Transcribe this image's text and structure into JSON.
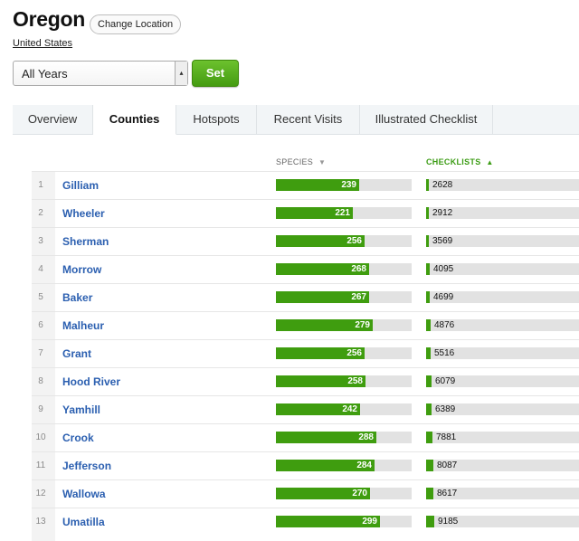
{
  "header": {
    "title": "Oregon",
    "change_location": "Change Location",
    "subtitle": "United States"
  },
  "controls": {
    "year_select": "All Years",
    "set_label": "Set"
  },
  "tabs": [
    {
      "label": "Overview",
      "active": false
    },
    {
      "label": "Counties",
      "active": true
    },
    {
      "label": "Hotspots",
      "active": false
    },
    {
      "label": "Recent Visits",
      "active": false
    },
    {
      "label": "Illustrated Checklist",
      "active": false
    }
  ],
  "columns": {
    "species": "SPECIES",
    "species_sort_icon": "triangle-down-icon",
    "checklists": "CHECKLISTS",
    "checklists_sort_icon": "triangle-up-icon"
  },
  "colors": {
    "accent_green": "#3f9d0f",
    "link_blue": "#2b5fb0"
  },
  "table": {
    "max_species": 390,
    "max_checklists": 180000,
    "rows": [
      {
        "rank": "1",
        "county": "Gilliam",
        "species": 239,
        "checklists": 2628
      },
      {
        "rank": "2",
        "county": "Wheeler",
        "species": 221,
        "checklists": 2912
      },
      {
        "rank": "3",
        "county": "Sherman",
        "species": 256,
        "checklists": 3569
      },
      {
        "rank": "4",
        "county": "Morrow",
        "species": 268,
        "checklists": 4095
      },
      {
        "rank": "5",
        "county": "Baker",
        "species": 267,
        "checklists": 4699
      },
      {
        "rank": "6",
        "county": "Malheur",
        "species": 279,
        "checklists": 4876
      },
      {
        "rank": "7",
        "county": "Grant",
        "species": 256,
        "checklists": 5516
      },
      {
        "rank": "8",
        "county": "Hood River",
        "species": 258,
        "checklists": 6079
      },
      {
        "rank": "9",
        "county": "Yamhill",
        "species": 242,
        "checklists": 6389
      },
      {
        "rank": "10",
        "county": "Crook",
        "species": 288,
        "checklists": 7881
      },
      {
        "rank": "11",
        "county": "Jefferson",
        "species": 284,
        "checklists": 8087
      },
      {
        "rank": "12",
        "county": "Wallowa",
        "species": 270,
        "checklists": 8617
      },
      {
        "rank": "13",
        "county": "Umatilla",
        "species": 299,
        "checklists": 9185
      }
    ]
  }
}
